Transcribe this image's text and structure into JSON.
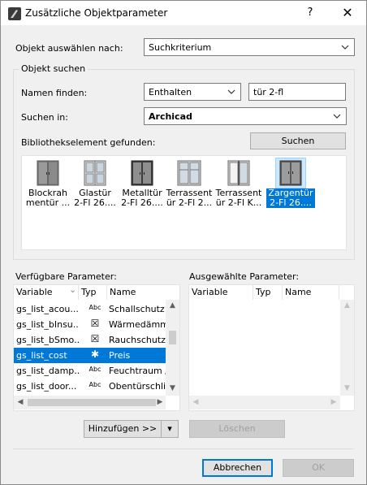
{
  "window": {
    "title": "Zusätzliche Objektparameter",
    "help_label": "?",
    "close_label": "✕"
  },
  "select_by": {
    "label": "Objekt auswählen nach:",
    "value": "Suchkriterium"
  },
  "search_group": {
    "title": "Objekt suchen",
    "name_label": "Namen finden:",
    "name_mode": "Enthalten",
    "name_value": "tür 2-fl",
    "search_in_label": "Suchen in:",
    "search_in_value": "Archicad",
    "found_label": "Bibliothekselement gefunden:",
    "search_button": "Suchen"
  },
  "library_items": [
    {
      "line1": "Blockrah",
      "line2": "mentür ...",
      "icon": "blockrahmentuer-thumbnail"
    },
    {
      "line1": "Glastür",
      "line2": "2-Fl 26....",
      "icon": "glastuer-thumbnail"
    },
    {
      "line1": "Metalltür",
      "line2": "2-Fl 26....",
      "icon": "metalltuer-thumbnail"
    },
    {
      "line1": "Terrassent",
      "line2": "ür 2-Fl 2...",
      "icon": "terrassentuer-thumbnail"
    },
    {
      "line1": "Terrassent",
      "line2": "ür 2-Fl K...",
      "icon": "terrassentuer-k-thumbnail"
    },
    {
      "line1": "Zargentür",
      "line2": "2-Fl 26....",
      "icon": "zargentuer-thumbnail"
    }
  ],
  "available": {
    "label": "Verfügbare Parameter:",
    "columns": [
      "Variable",
      "Typ",
      "Name"
    ],
    "rows": [
      {
        "variable": "gs_list_acou...",
        "type": "Abc",
        "name": "Schallschutz"
      },
      {
        "variable": "gs_list_bInsu...",
        "type": "☒",
        "name": "Wärmedämm..."
      },
      {
        "variable": "gs_list_bSmo...",
        "type": "☒",
        "name": "Rauchschutz ..."
      },
      {
        "variable": "gs_list_cost",
        "type": "✱",
        "name": "Preis"
      },
      {
        "variable": "gs_list_damp...",
        "type": "Abc",
        "name": "Feuchtraum /..."
      },
      {
        "variable": "gs_list_door...",
        "type": "Abc",
        "name": "Obentürschli..."
      }
    ],
    "selected_index": 3,
    "sort_indicator": "⌄"
  },
  "selected_params": {
    "label": "Ausgewählte Parameter:",
    "columns": [
      "Variable",
      "Typ",
      "Name"
    ]
  },
  "actions": {
    "add": "Hinzufügen >>",
    "add_dropdown": "▾",
    "delete": "Löschen"
  },
  "footer": {
    "cancel": "Abbrechen",
    "ok": "OK"
  },
  "colors": {
    "selection": "#0078d7",
    "window_bg": "#f0f0f0",
    "accent_border": "#0078d7"
  }
}
